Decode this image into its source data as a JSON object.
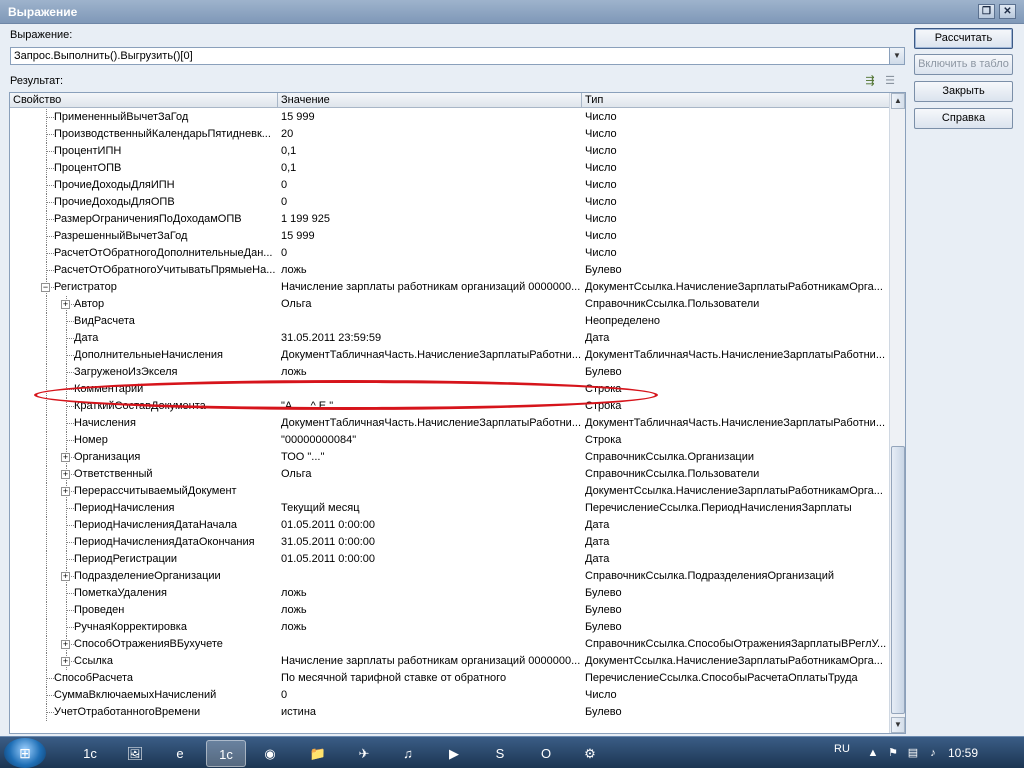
{
  "window": {
    "title": "Выражение",
    "restore_icon": "restore-icon",
    "close_icon": "close-icon"
  },
  "expression": {
    "label": "Выражение:",
    "value": "Запрос.Выполнить().Выгрузить()[0]"
  },
  "result": {
    "label": "Результат:"
  },
  "buttons": {
    "calculate": "Рассчитать",
    "to_table": "Включить в табло",
    "close": "Закрыть",
    "help": "Справка"
  },
  "grid": {
    "columns": [
      "Свойство",
      "Значение",
      "Тип"
    ],
    "rows": [
      {
        "name": "ПримененныйВычетЗаГод",
        "value": "15 999",
        "type": "Число",
        "level": 2,
        "expand": false
      },
      {
        "name": "ПроизводственныйКалендарьПятидневк...",
        "value": "20",
        "type": "Число",
        "level": 2,
        "expand": false
      },
      {
        "name": "ПроцентИПН",
        "value": "0,1",
        "type": "Число",
        "level": 2,
        "expand": false
      },
      {
        "name": "ПроцентОПВ",
        "value": "0,1",
        "type": "Число",
        "level": 2,
        "expand": false
      },
      {
        "name": "ПрочиеДоходыДляИПН",
        "value": "0",
        "type": "Число",
        "level": 2,
        "expand": false
      },
      {
        "name": "ПрочиеДоходыДляОПВ",
        "value": "0",
        "type": "Число",
        "level": 2,
        "expand": false
      },
      {
        "name": "РазмерОграниченияПоДоходамОПВ",
        "value": "1 199 925",
        "type": "Число",
        "level": 2,
        "expand": false
      },
      {
        "name": "РазрешенныйВычетЗаГод",
        "value": "15 999",
        "type": "Число",
        "level": 2,
        "expand": false
      },
      {
        "name": "РасчетОтОбратногоДополнительныеДан...",
        "value": "0",
        "type": "Число",
        "level": 2,
        "expand": false
      },
      {
        "name": "РасчетОтОбратногоУчитыватьПрямыеНа...",
        "value": "ложь",
        "type": "Булево",
        "level": 2,
        "expand": false
      },
      {
        "name": "Регистратор",
        "value": "Начисление зарплаты работникам организаций 0000000...",
        "type": "ДокументСсылка.НачислениеЗарплатыРаботникамОрга...",
        "level": 2,
        "expand": "minus"
      },
      {
        "name": "Автор",
        "value": "Ольга",
        "type": "СправочникСсылка.Пользователи",
        "level": 3,
        "expand": "plus"
      },
      {
        "name": "ВидРасчета",
        "value": "",
        "type": "Неопределено",
        "level": 3,
        "expand": false
      },
      {
        "name": "Дата",
        "value": "31.05.2011 23:59:59",
        "type": "Дата",
        "level": 3,
        "expand": false
      },
      {
        "name": "ДополнительныеНачисления",
        "value": "ДокументТабличнаяЧасть.НачислениеЗарплатыРаботни...",
        "type": "ДокументТабличнаяЧасть.НачислениеЗарплатыРаботни...",
        "level": 3,
        "expand": false
      },
      {
        "name": "ЗагруженоИзЭкселя",
        "value": "ложь",
        "type": "Булево",
        "level": 3,
        "expand": false
      },
      {
        "name": "Комментарий",
        "value": "",
        "type": "Строка",
        "level": 3,
        "expand": false
      },
      {
        "name": "КраткийСоставДокумента",
        "value": "\"А..... ^.Е.\"",
        "type": "Строка",
        "level": 3,
        "expand": false
      },
      {
        "name": "Начисления",
        "value": "ДокументТабличнаяЧасть.НачислениеЗарплатыРаботни...",
        "type": "ДокументТабличнаяЧасть.НачислениеЗарплатыРаботни...",
        "level": 3,
        "expand": false
      },
      {
        "name": "Номер",
        "value": "\"00000000084\"",
        "type": "Строка",
        "level": 3,
        "expand": false
      },
      {
        "name": "Организация",
        "value": "ТОО \"...\"",
        "type": "СправочникСсылка.Организации",
        "level": 3,
        "expand": "plus"
      },
      {
        "name": "Ответственный",
        "value": "Ольга",
        "type": "СправочникСсылка.Пользователи",
        "level": 3,
        "expand": "plus"
      },
      {
        "name": "ПерерассчитываемыйДокумент",
        "value": "",
        "type": "ДокументСсылка.НачислениеЗарплатыРаботникамОрга...",
        "level": 3,
        "expand": "plus"
      },
      {
        "name": "ПериодНачисления",
        "value": "Текущий месяц",
        "type": "ПеречислениеСсылка.ПериодНачисленияЗарплаты",
        "level": 3,
        "expand": false
      },
      {
        "name": "ПериодНачисленияДатаНачала",
        "value": "01.05.2011 0:00:00",
        "type": "Дата",
        "level": 3,
        "expand": false
      },
      {
        "name": "ПериодНачисленияДатаОкончания",
        "value": "31.05.2011 0:00:00",
        "type": "Дата",
        "level": 3,
        "expand": false
      },
      {
        "name": "ПериодРегистрации",
        "value": "01.05.2011 0:00:00",
        "type": "Дата",
        "level": 3,
        "expand": false
      },
      {
        "name": "ПодразделениеОрганизации",
        "value": "",
        "type": "СправочникСсылка.ПодразделенияОрганизаций",
        "level": 3,
        "expand": "plus"
      },
      {
        "name": "ПометкаУдаления",
        "value": "ложь",
        "type": "Булево",
        "level": 3,
        "expand": false
      },
      {
        "name": "Проведен",
        "value": "ложь",
        "type": "Булево",
        "level": 3,
        "expand": false
      },
      {
        "name": "РучнаяКорректировка",
        "value": "ложь",
        "type": "Булево",
        "level": 3,
        "expand": false
      },
      {
        "name": "СпособОтраженияВБухучете",
        "value": "",
        "type": "СправочникСсылка.СпособыОтраженияЗарплатыВРеглУ...",
        "level": 3,
        "expand": "plus"
      },
      {
        "name": "Ссылка",
        "value": "Начисление зарплаты работникам организаций 0000000...",
        "type": "ДокументСсылка.НачислениеЗарплатыРаботникамОрга...",
        "level": 3,
        "expand": "plus"
      },
      {
        "name": "СпособРасчета",
        "value": "По месячной тарифной ставке от обратного",
        "type": "ПеречислениеСсылка.СпособыРасчетаОплатыТруда",
        "level": 2,
        "expand": false
      },
      {
        "name": "СуммаВключаемыхНачислений",
        "value": "0",
        "type": "Число",
        "level": 2,
        "expand": false
      },
      {
        "name": "УчетОтработанногоВремени",
        "value": "истина",
        "type": "Булево",
        "level": 2,
        "expand": false
      }
    ]
  },
  "taskbar": {
    "lang": "RU",
    "clock": "10:59",
    "apps": [
      "1c-icon",
      "paint-icon",
      "ie-icon",
      "1c-enterprise-icon",
      "chrome-icon",
      "folder-icon",
      "ftp-icon",
      "itunes-icon",
      "media-icon",
      "skype-icon",
      "outlook-icon",
      "tool-icon"
    ]
  }
}
